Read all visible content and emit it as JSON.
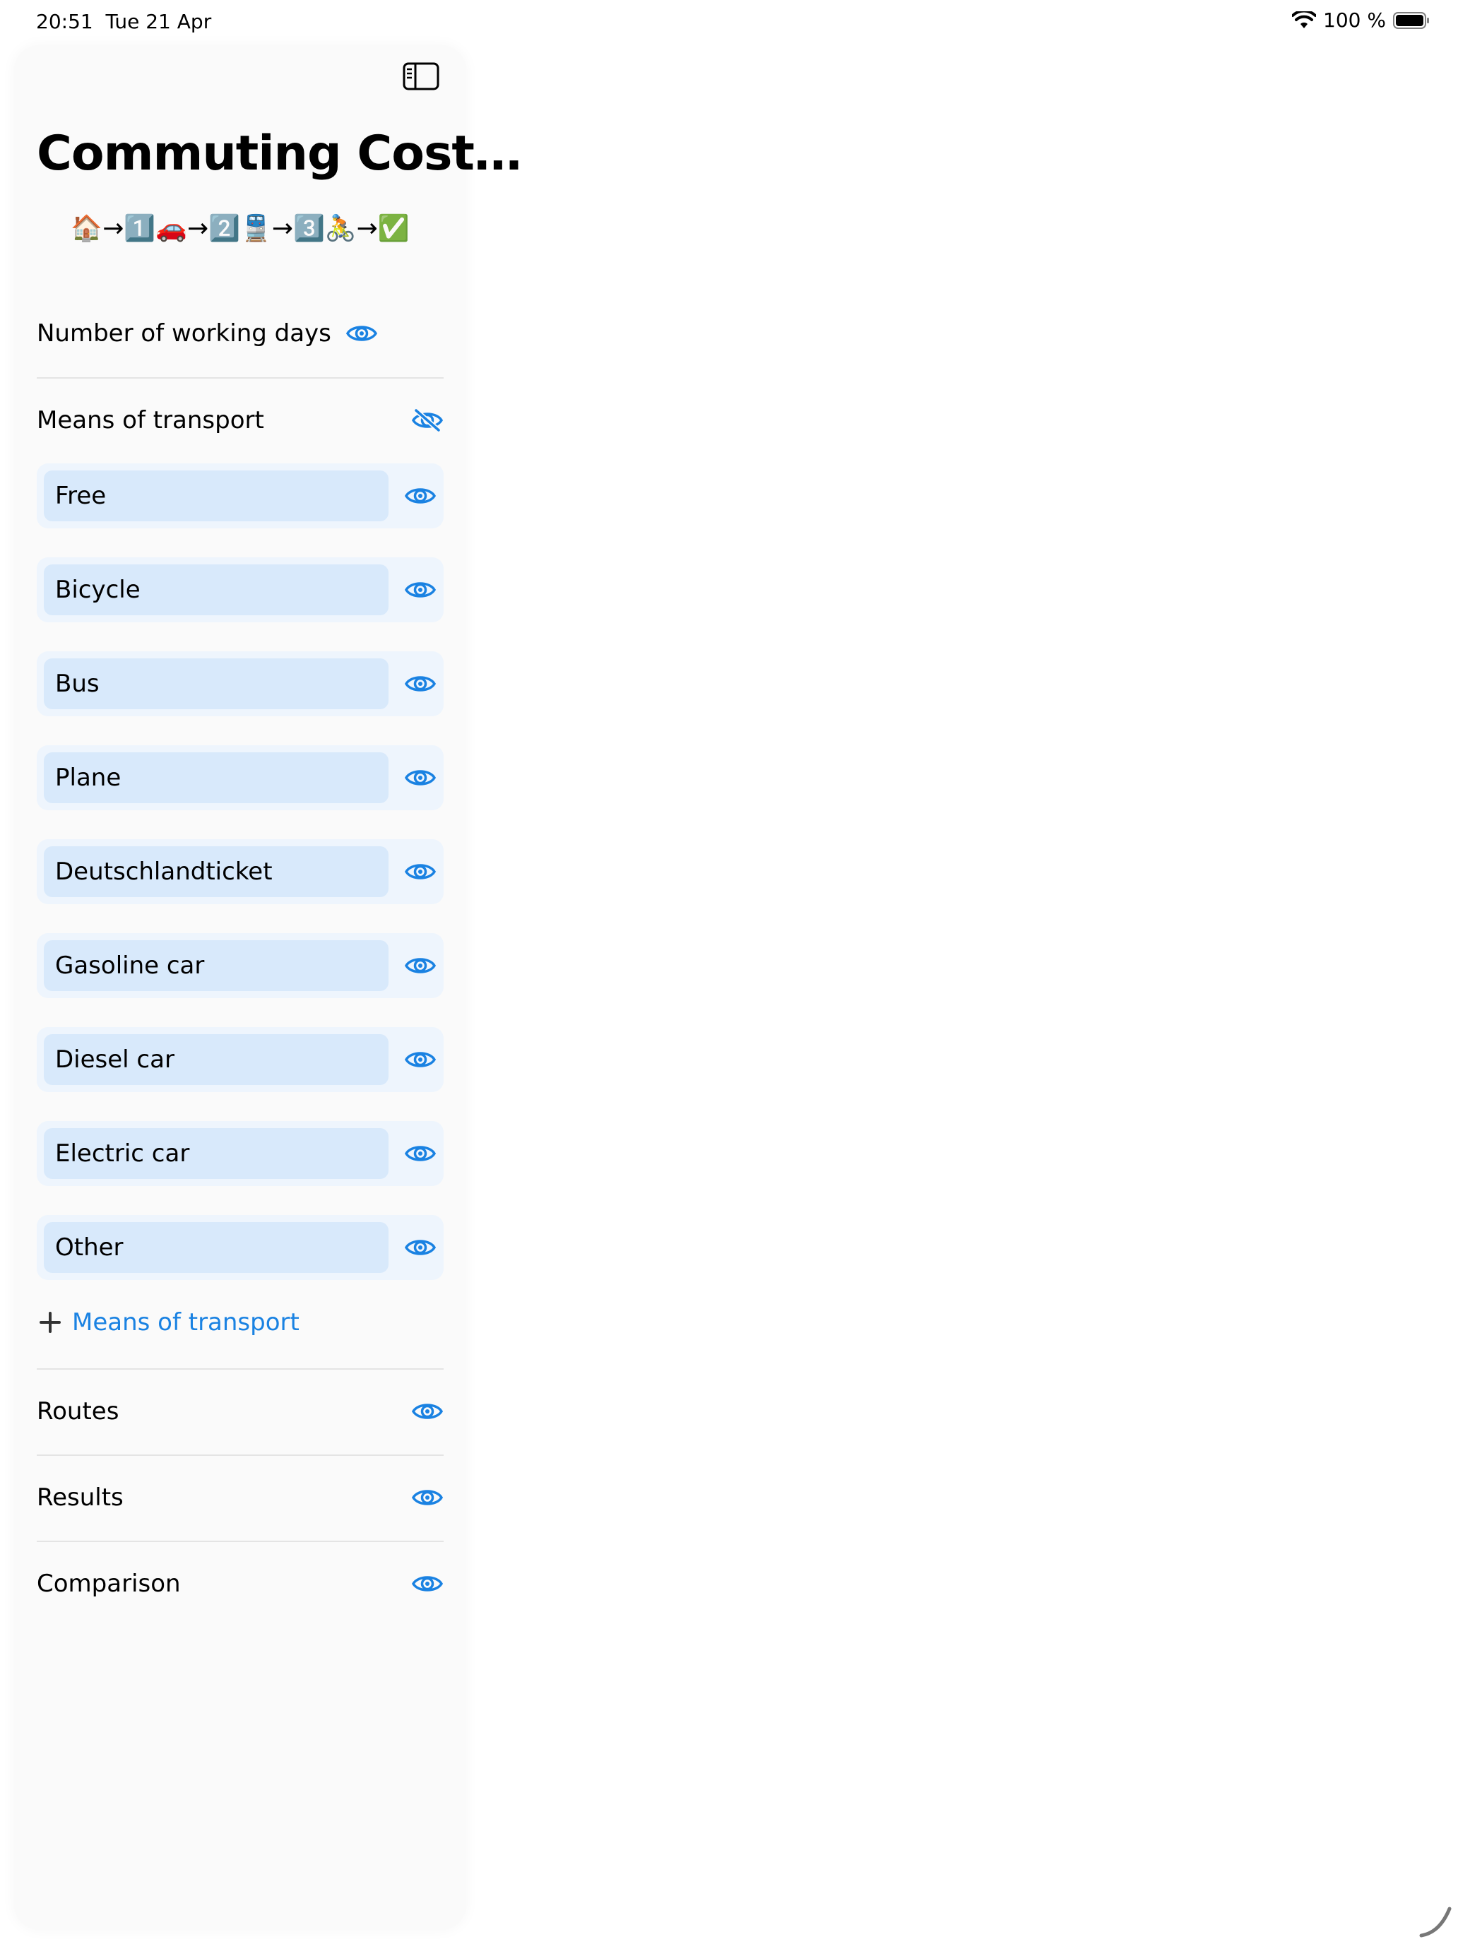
{
  "status_bar": {
    "time": "20:51",
    "date": "Tue 21 Apr",
    "battery": "100 %",
    "wifi_icon": "wifi-icon",
    "battery_icon": "battery-icon"
  },
  "sidebar": {
    "title": "Commuting Cost…",
    "emoji_route": "🏠→1️⃣🚗→2️⃣🚆→3️⃣🚴→✅",
    "working_days_label": "Number of working days",
    "means_label": "Means of transport",
    "transports": [
      {
        "label": "Free"
      },
      {
        "label": "Bicycle"
      },
      {
        "label": "Bus"
      },
      {
        "label": "Plane"
      },
      {
        "label": "Deutschlandticket"
      },
      {
        "label": "Gasoline car"
      },
      {
        "label": "Diesel car"
      },
      {
        "label": "Electric car"
      },
      {
        "label": "Other"
      }
    ],
    "add_means_label": "Means of transport",
    "routes_label": "Routes",
    "results_label": "Results",
    "comparison_label": "Comparison"
  },
  "colors": {
    "accent": "#1a82e2",
    "card_bg": "#eef5fd",
    "field_bg": "#d8e9fb"
  }
}
